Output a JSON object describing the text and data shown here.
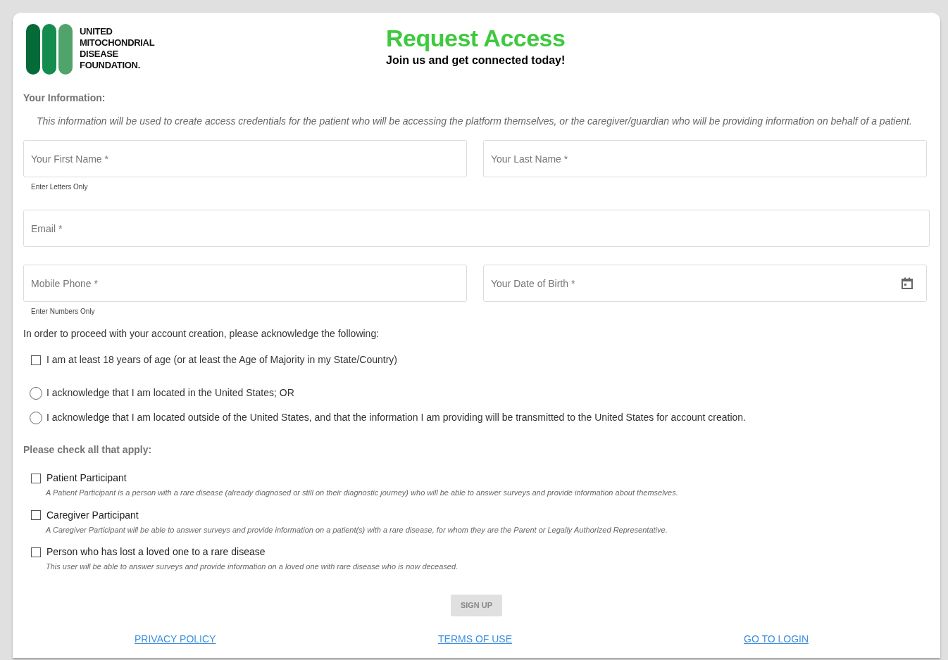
{
  "logo": {
    "lines": [
      "UNITED",
      "MITOCHONDRIAL",
      "DISEASE",
      "FOUNDATION."
    ]
  },
  "header": {
    "title": "Request Access",
    "subtitle": "Join us and get connected today!"
  },
  "your_information": {
    "heading": "Your Information:",
    "description": "This information will be used to create access credentials for the patient who will be accessing the platform themselves, or the caregiver/guardian who will be providing information on behalf of a patient."
  },
  "field_rows": [
    [
      {
        "placeholder": "Your First Name *",
        "helper": "Enter Letters Only",
        "kind": "text"
      },
      {
        "placeholder": "Your Last Name *",
        "kind": "text"
      }
    ],
    [
      {
        "placeholder": "Email *",
        "kind": "text"
      }
    ],
    [
      {
        "placeholder": "Mobile Phone *",
        "helper": "Enter Numbers Only",
        "kind": "text"
      },
      {
        "placeholder": "Your Date of Birth *",
        "kind": "date"
      }
    ]
  ],
  "acknowledge": {
    "intro": "In order to proceed with your account creation, please acknowledge the following:",
    "age_check": {
      "label": "I am at least 18 years of age (or at least the Age of Majority in my State/Country)",
      "checked": false
    },
    "location_options": [
      {
        "label": "I acknowledge that I am located in the United States; OR",
        "selected": false
      },
      {
        "label": "I acknowledge that I am located outside of the United States, and that the information I am providing will be transmitted to the United States for account creation.",
        "selected": false
      }
    ]
  },
  "roles": {
    "heading": "Please check all that apply:",
    "options": [
      {
        "label": "Patient Participant",
        "description": "A Patient Participant is a person with a rare disease (already diagnosed or still on their diagnostic journey) who will be able to answer surveys and provide information about themselves.",
        "checked": false
      },
      {
        "label": "Caregiver Participant",
        "description": "A Caregiver Participant will be able to answer surveys and provide information on a patient(s) with a rare disease, for whom they are the Parent or Legally Authorized Representative.",
        "checked": false
      },
      {
        "label": "Person who has lost a loved one to a rare disease",
        "description": "This user will be able to answer surveys and provide information on a loved one with rare disease who is now deceased.",
        "checked": false
      }
    ]
  },
  "sign_up": {
    "label": "SIGN UP",
    "disabled": true
  },
  "links": [
    "PRIVACY POLICY",
    "TERMS OF USE",
    "GO TO LOGIN"
  ]
}
